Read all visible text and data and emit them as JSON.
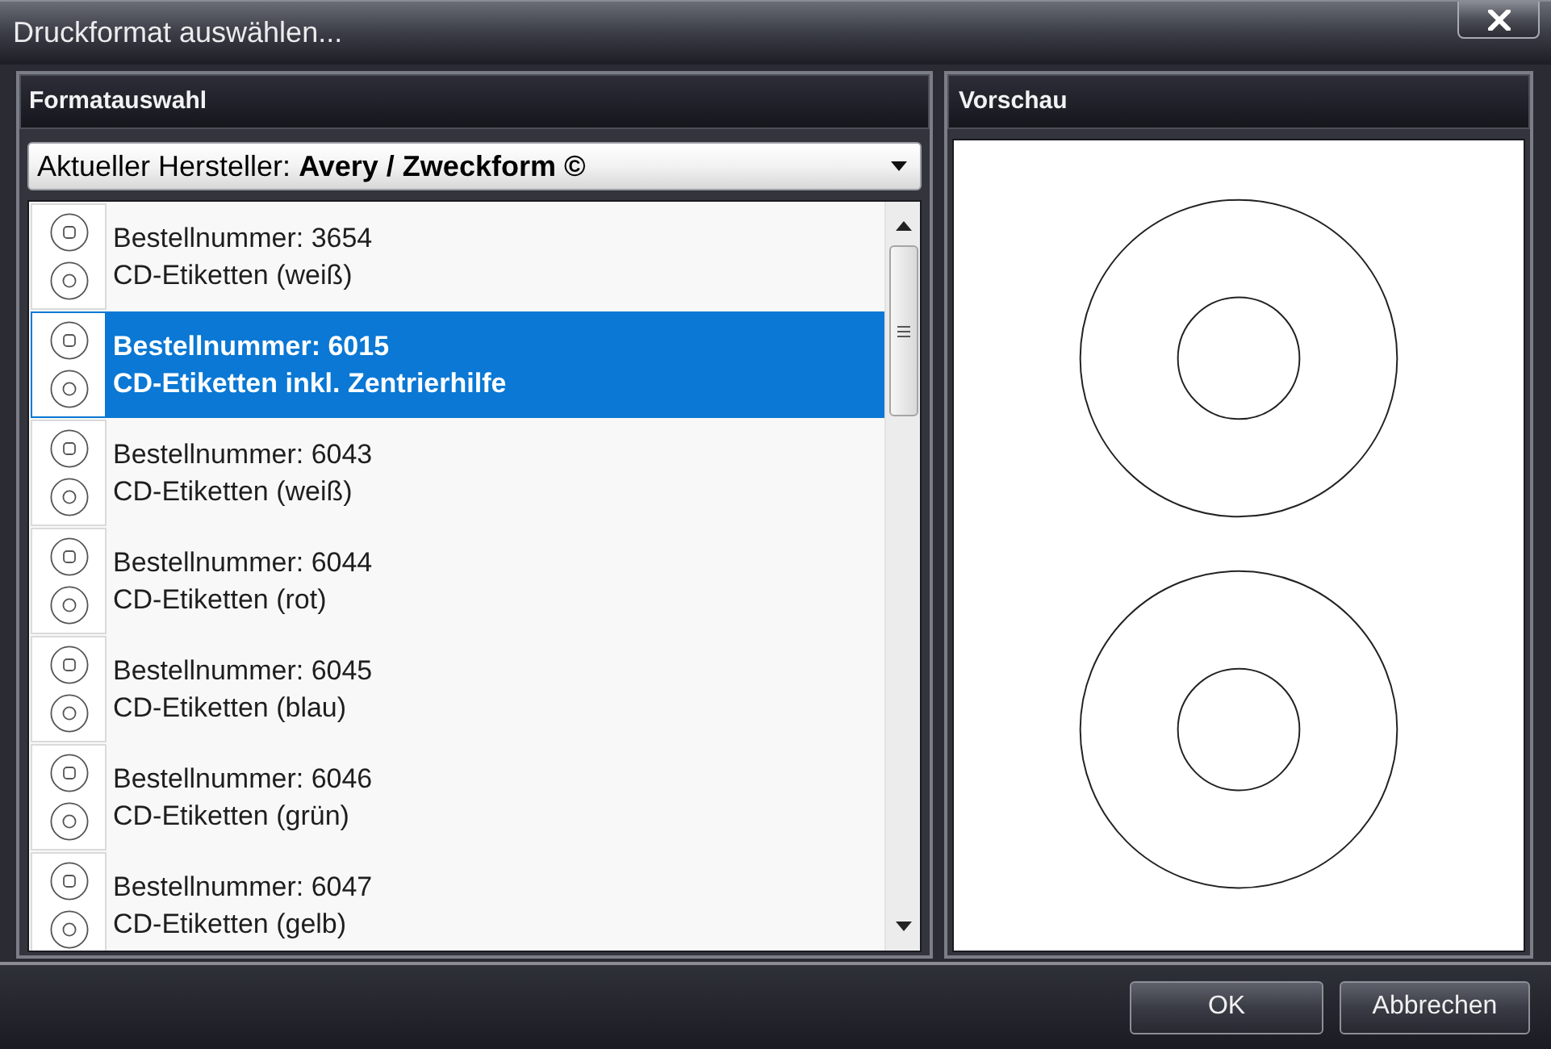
{
  "window": {
    "title": "Druckformat auswählen..."
  },
  "format_panel": {
    "title": "Formatauswahl",
    "manufacturer": "Aktueller Hersteller: **Avery / Zweckform ©**",
    "formats": [
      {
        "order_number": "Bestellnummer: 3654",
        "description": "CD-Etiketten (weiß)",
        "selected": false
      },
      {
        "order_number": "Bestellnummer: 6015",
        "description": "CD-Etiketten inkl. Zentrierhilfe",
        "selected": true
      },
      {
        "order_number": "Bestellnummer: 6043",
        "description": "CD-Etiketten (weiß)",
        "selected": false
      },
      {
        "order_number": "Bestellnummer: 6044",
        "description": "CD-Etiketten (rot)",
        "selected": false
      },
      {
        "order_number": "Bestellnummer: 6045",
        "description": "CD-Etiketten (blau)",
        "selected": false
      },
      {
        "order_number": "Bestellnummer: 6046",
        "description": "CD-Etiketten (grün)",
        "selected": false
      },
      {
        "order_number": "Bestellnummer: 6047",
        "description": "CD-Etiketten (gelb)",
        "selected": false
      }
    ]
  },
  "preview_panel": {
    "title": "Vorschau"
  },
  "buttons": [
    {
      "label": "OK"
    },
    {
      "label": "Abbrechen"
    }
  ]
}
